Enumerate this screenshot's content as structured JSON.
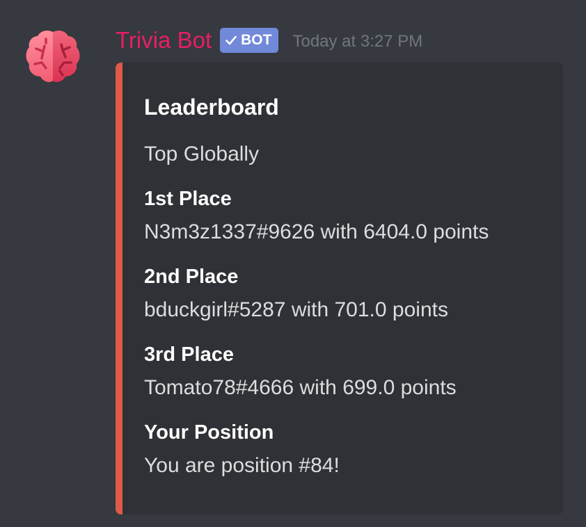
{
  "message": {
    "author": "Trivia Bot",
    "bot_tag": "BOT",
    "timestamp": "Today at 3:27 PM",
    "avatar_icon": "brain-icon",
    "colors": {
      "username": "#e91e63",
      "bot_tag": "#7289da",
      "embed_accent": "#dd5b47",
      "background": "#36393f",
      "embed_background": "#2f3136"
    }
  },
  "embed": {
    "title": "Leaderboard",
    "description": "Top Globally",
    "fields": [
      {
        "name": "1st Place",
        "value": "N3m3z1337#9626 with 6404.0 points"
      },
      {
        "name": "2nd Place",
        "value": "bduckgirl#5287 with 701.0 points"
      },
      {
        "name": "3rd Place",
        "value": "Tomato78#4666 with 699.0 points"
      },
      {
        "name": "Your Position",
        "value": "You are position #84!"
      }
    ]
  }
}
